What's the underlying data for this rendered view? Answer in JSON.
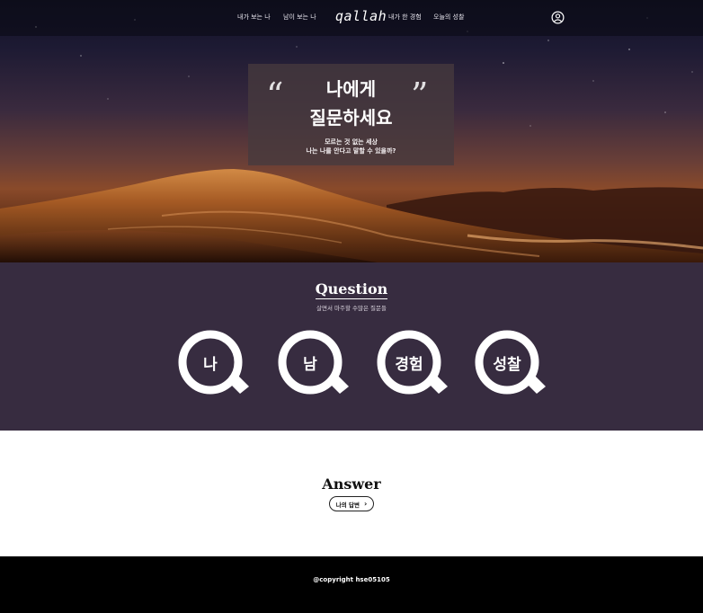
{
  "nav": {
    "items": [
      "내가 보는 나",
      "남이 보는 나",
      "내가 한 경험",
      "오늘의 성찰"
    ],
    "logo": "qallah",
    "profile_icon": "user-circle-icon"
  },
  "hero": {
    "open_quote": "“",
    "close_quote": "”",
    "title_line1": "나에게",
    "title_line2": "질문하세요",
    "subtitle_line1": "모르는 것 없는 세상",
    "subtitle_line2": "나는 나를 안다고 말할 수 있을까?"
  },
  "question": {
    "heading": "Question",
    "subheading": "살면서 마주할 수많은 질문들",
    "items": [
      "나",
      "남",
      "경험",
      "성찰"
    ],
    "icon": "magnifier-q-icon"
  },
  "answer": {
    "heading": "Answer",
    "button_label": "나의 답변",
    "button_icon": "chevron-right-icon"
  },
  "footer": {
    "copyright": "@copyright hse05105"
  },
  "colors": {
    "question_bg": "#372c40",
    "answer_bg": "#ffffff",
    "footer_bg": "#000000"
  }
}
